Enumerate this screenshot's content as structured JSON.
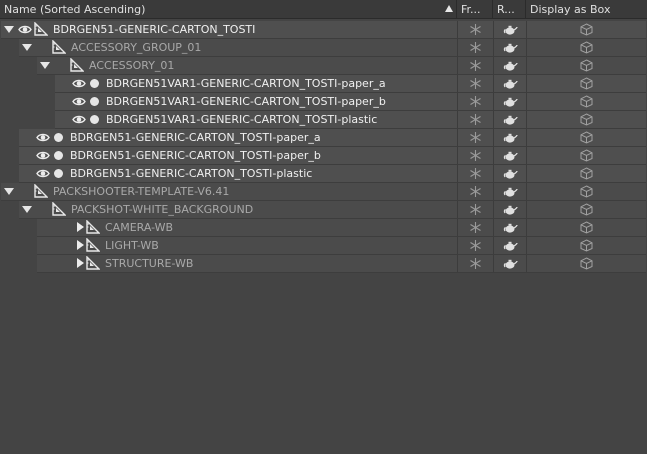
{
  "columns": {
    "name": "Name (Sorted Ascending)",
    "freeze": "Fr...",
    "render": "R...",
    "display_box": "Display as Box"
  },
  "colors": {
    "background": "#444444",
    "row": "#4f4f4f",
    "header": "#3a3a3a",
    "text": "#f0f0f0",
    "text_dim": "#a9a9a9"
  },
  "rows": [
    {
      "label": "BDRGEN51-GENERIC-CARTON_TOSTI",
      "level": 0,
      "expander": "down",
      "visible": true,
      "dot": false,
      "dim": false,
      "icon": "bone-icon"
    },
    {
      "label": "ACCESSORY_GROUP_01",
      "level": 1,
      "expander": "down",
      "visible": false,
      "dot": false,
      "dim": true,
      "icon": "bone-icon"
    },
    {
      "label": "ACCESSORY_01",
      "level": 2,
      "expander": "down",
      "visible": false,
      "dot": false,
      "dim": true,
      "icon": "bone-icon"
    },
    {
      "label": "BDRGEN51VAR1-GENERIC-CARTON_TOSTI-paper_a",
      "level": 3,
      "expander": "none",
      "visible": true,
      "dot": true,
      "dim": false,
      "icon": "none"
    },
    {
      "label": "BDRGEN51VAR1-GENERIC-CARTON_TOSTI-paper_b",
      "level": 3,
      "expander": "none",
      "visible": true,
      "dot": true,
      "dim": false,
      "icon": "none"
    },
    {
      "label": "BDRGEN51VAR1-GENERIC-CARTON_TOSTI-plastic",
      "level": 3,
      "expander": "none",
      "visible": true,
      "dot": true,
      "dim": false,
      "icon": "none"
    },
    {
      "label": "BDRGEN51-GENERIC-CARTON_TOSTI-paper_a",
      "level": 1,
      "expander": "none",
      "visible": true,
      "dot": true,
      "dim": false,
      "icon": "none"
    },
    {
      "label": "BDRGEN51-GENERIC-CARTON_TOSTI-paper_b",
      "level": 1,
      "expander": "none",
      "visible": true,
      "dot": true,
      "dim": false,
      "icon": "none"
    },
    {
      "label": "BDRGEN51-GENERIC-CARTON_TOSTI-plastic",
      "level": 1,
      "expander": "none",
      "visible": true,
      "dot": true,
      "dim": false,
      "icon": "none"
    },
    {
      "label": "PACKSHOOTER-TEMPLATE-V6.41",
      "level": 0,
      "expander": "down",
      "visible": false,
      "dot": false,
      "dim": true,
      "icon": "bone-icon"
    },
    {
      "label": "PACKSHOT-WHITE_BACKGROUND",
      "level": 1,
      "expander": "down",
      "visible": false,
      "dot": false,
      "dim": true,
      "icon": "bone-icon"
    },
    {
      "label": "CAMERA-WB",
      "level": 2,
      "expander": "right",
      "visible": false,
      "dot": false,
      "dim": true,
      "icon": "bone-icon"
    },
    {
      "label": "LIGHT-WB",
      "level": 2,
      "expander": "right",
      "visible": false,
      "dot": false,
      "dim": true,
      "icon": "bone-icon"
    },
    {
      "label": "STRUCTURE-WB",
      "level": 2,
      "expander": "right",
      "visible": false,
      "dot": false,
      "dim": true,
      "icon": "bone-icon"
    }
  ],
  "row_icons": {
    "freeze": "snowflake-icon",
    "render": "teapot-icon",
    "display_box": "box-icon"
  }
}
